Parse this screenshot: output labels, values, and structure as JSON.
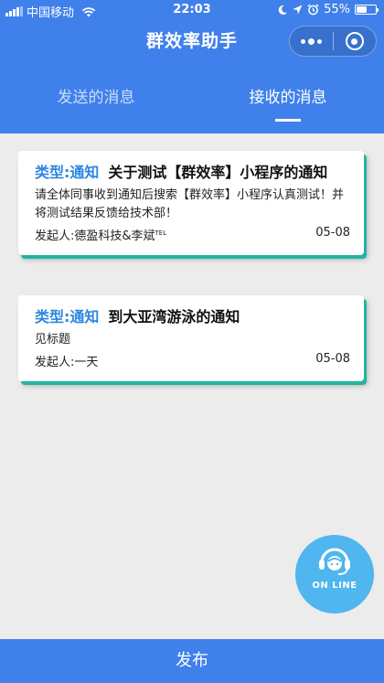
{
  "status_bar": {
    "carrier": "中国移动",
    "time": "22:03",
    "battery": "55%",
    "battery_level": 0.55
  },
  "header": {
    "title": "群效率助手",
    "menu_icon": "more-dots-icon",
    "close_icon": "target-circle-icon"
  },
  "tabs": [
    {
      "label": "发送的消息",
      "active": false
    },
    {
      "label": "接收的消息",
      "active": true
    }
  ],
  "messages": [
    {
      "type": "类型:通知",
      "title": "关于测试【群效率】小程序的通知",
      "body": "请全体同事收到通知后搜索【群效率】小程序认真测试！并将测试结果反馈给技术部！",
      "sender": "发起人:德盈科技&李斌",
      "sender_sup": "TEL",
      "date": "05-08"
    },
    {
      "type": "类型:通知",
      "title": "到大亚湾游泳的通知",
      "body": "见标题",
      "sender": "发起人:一天",
      "sender_sup": "",
      "date": "05-08"
    }
  ],
  "online_button": {
    "label": "ON LINE",
    "icon": "headset-agent-icon"
  },
  "bottom_bar": {
    "publish_label": "发布"
  },
  "colors": {
    "primary": "#4080ea",
    "accent": "#2c87e0",
    "shadow": "#23b3a3",
    "online": "#4fb6ef"
  }
}
